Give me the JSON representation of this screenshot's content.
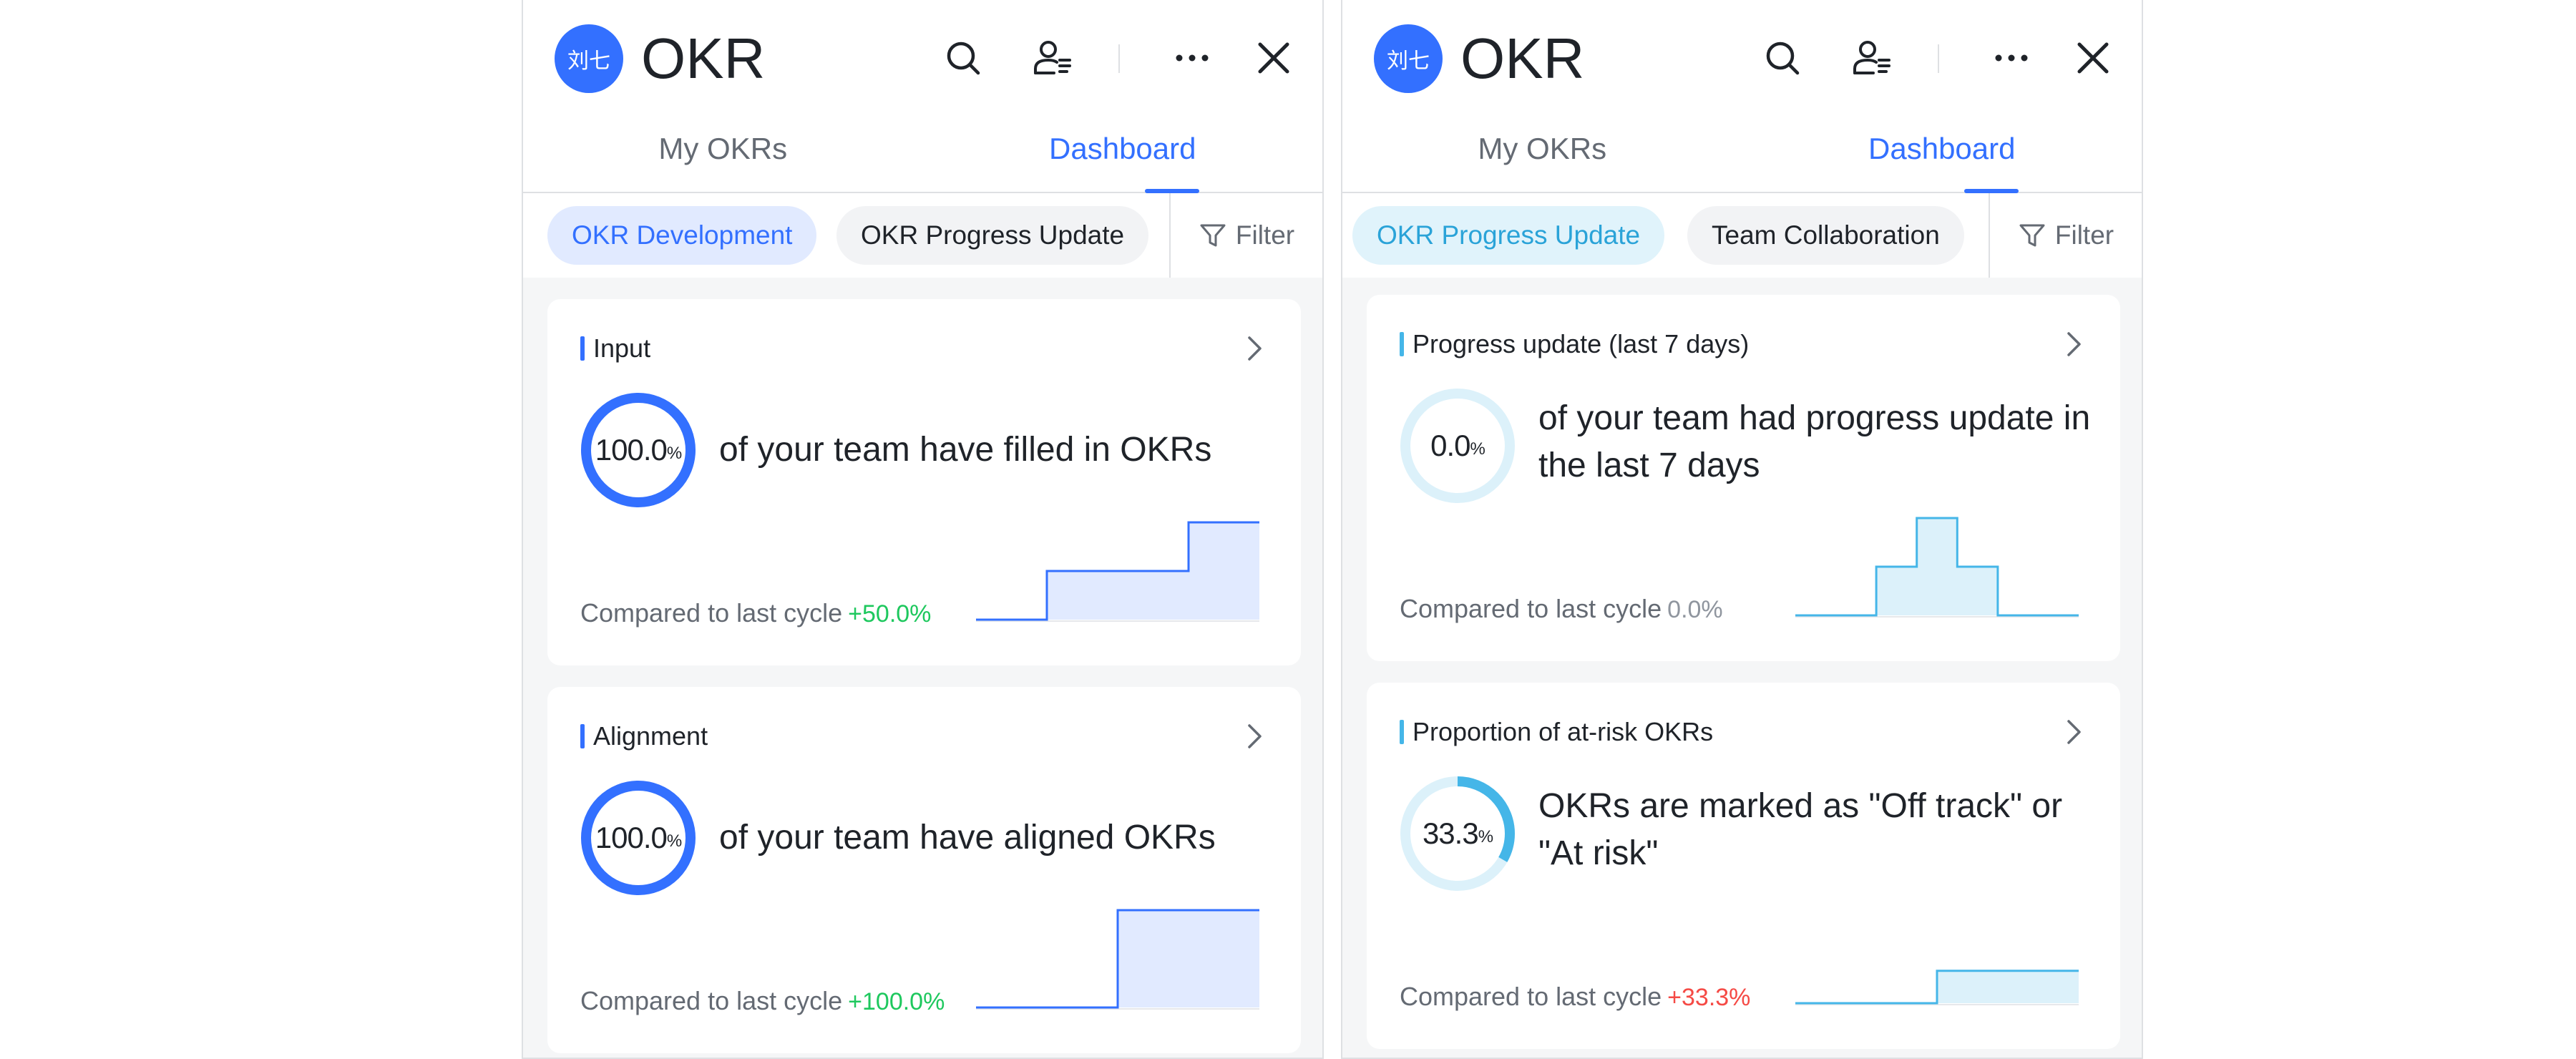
{
  "colors": {
    "brand_blue": "#3370ff",
    "accent_cyan": "#45b6e8",
    "positive": "#1ec85e",
    "negative": "#f54a45",
    "neutral": "#8f959e"
  },
  "panels": [
    {
      "avatar_text": "刘七",
      "app_title": "OKR",
      "icons": [
        "search-icon",
        "add-user-icon",
        "more-icon",
        "close-icon"
      ],
      "tabs": [
        {
          "label": "My OKRs",
          "active": false
        },
        {
          "label": "Dashboard",
          "active": true
        }
      ],
      "chips": [
        {
          "label": "OKR Development",
          "active": true
        },
        {
          "label": "OKR Progress Update",
          "active": false
        }
      ],
      "filter_label": "Filter",
      "cards": [
        {
          "title": "Input",
          "ring_value": "100.0",
          "ring_unit": "%",
          "ring_fraction": 1.0,
          "statement": "of your team have filled in OKRs",
          "compare_label": "Compared to last cycle",
          "compare_value": "+50.0%",
          "trend": [
            0,
            0.5,
            0.5,
            1.0
          ]
        },
        {
          "title": "Alignment",
          "ring_value": "100.0",
          "ring_unit": "%",
          "ring_fraction": 1.0,
          "statement": "of your team have aligned OKRs",
          "compare_label": "Compared to last cycle",
          "compare_value": "+100.0%",
          "trend": [
            0,
            0,
            1.0,
            1.0
          ]
        }
      ]
    },
    {
      "avatar_text": "刘七",
      "app_title": "OKR",
      "icons": [
        "search-icon",
        "add-user-icon",
        "more-icon",
        "close-icon"
      ],
      "tabs": [
        {
          "label": "My OKRs",
          "active": false
        },
        {
          "label": "Dashboard",
          "active": true
        }
      ],
      "chips": [
        {
          "label": "OKR Progress Update",
          "active": true
        },
        {
          "label": "Team Collaboration",
          "active": false
        }
      ],
      "filter_label": "Filter",
      "cards": [
        {
          "title": "Progress update (last 7 days)",
          "ring_value": "0.0",
          "ring_unit": "%",
          "ring_fraction": 0.0,
          "statement": "of your team had progress update in the last 7 days",
          "compare_label": "Compared to last cycle",
          "compare_value": "0.0%",
          "trend": [
            0,
            0,
            0.5,
            1.0,
            0.5,
            0,
            0
          ]
        },
        {
          "title": "Proportion of at-risk OKRs",
          "ring_value": "33.3",
          "ring_unit": "%",
          "ring_fraction": 0.333,
          "statement": "OKRs are marked as \"Off track\" or \"At risk\"",
          "compare_label": "Compared to last cycle",
          "compare_value": "+33.3%",
          "trend": [
            0,
            0,
            0.333,
            0.333
          ]
        }
      ]
    }
  ]
}
